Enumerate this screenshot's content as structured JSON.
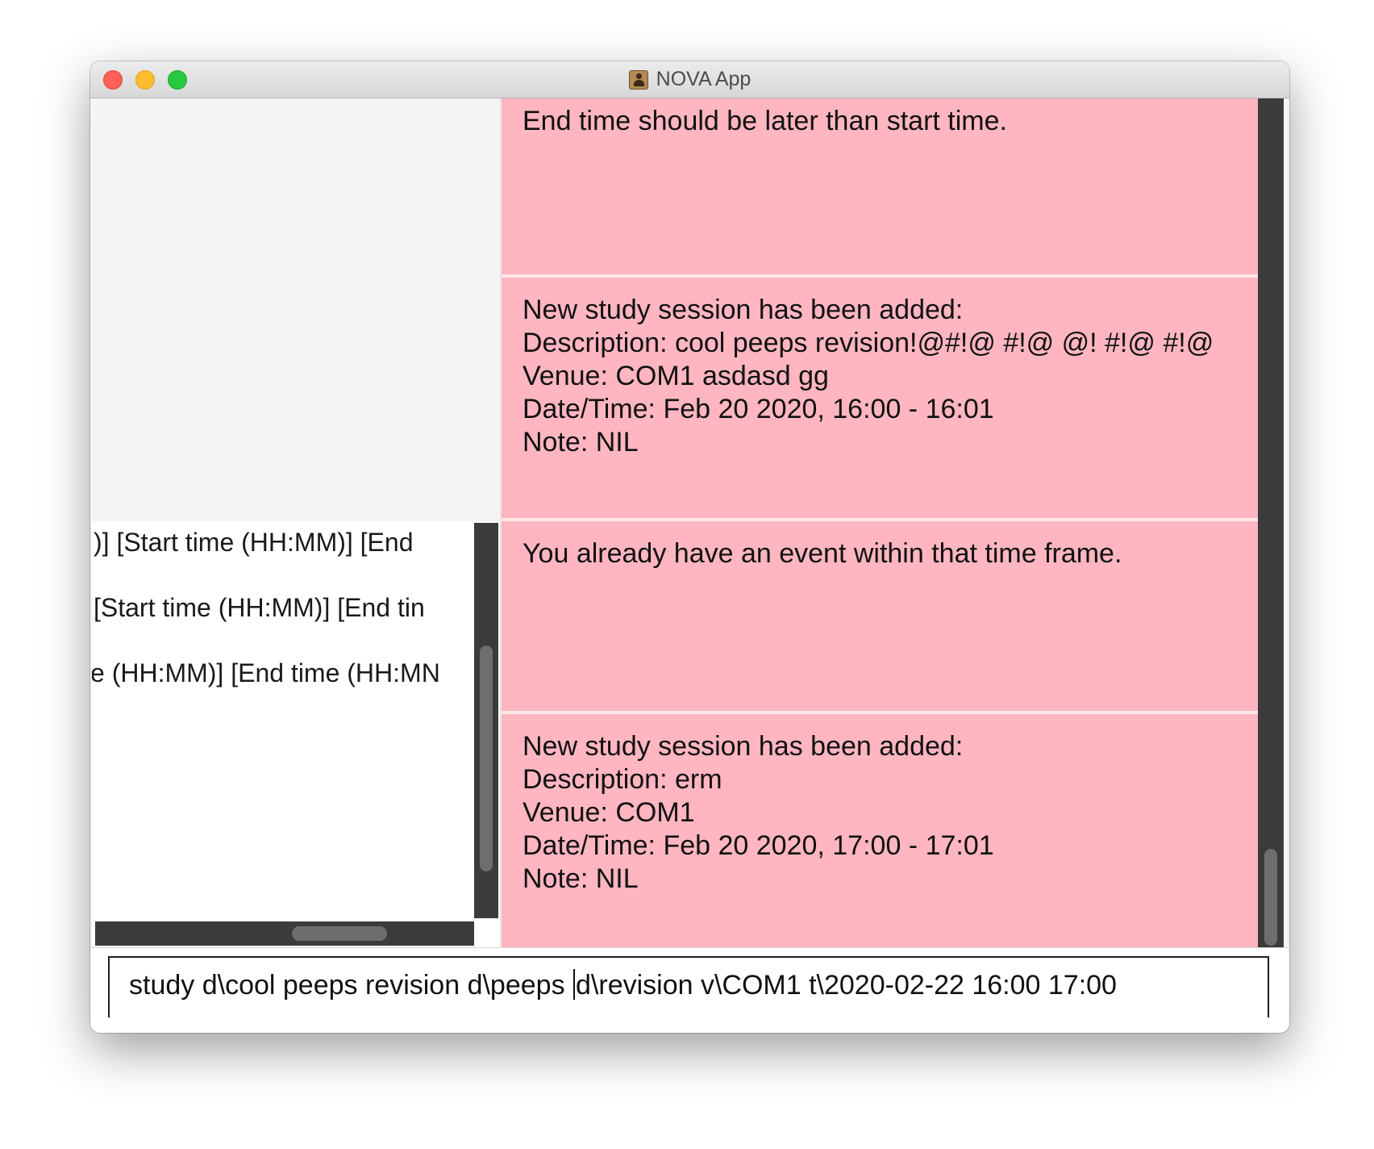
{
  "window": {
    "title": "NOVA App",
    "icon": "address-book-icon"
  },
  "help_panel": {
    "lines": [
      ")] [Start time (HH:MM)] [End",
      "[Start time (HH:MM)] [End tin",
      "e (HH:MM)] [End time (HH:MN"
    ]
  },
  "results": {
    "cards": [
      {
        "lines": [
          "End time should be later than start time."
        ]
      },
      {
        "lines": [
          "New study session has been added:",
          "Description: cool peeps revision!@#!@ #!@ @! #!@ #!@",
          "Venue: COM1 asdasd gg",
          "Date/Time: Feb 20 2020, 16:00 - 16:01",
          "Note: NIL"
        ]
      },
      {
        "lines": [
          "You already have an event within that time frame."
        ]
      },
      {
        "lines": [
          "New study session has been added:",
          "Description: erm",
          "Venue: COM1",
          "Date/Time: Feb 20 2020, 17:00 - 17:01",
          "Note: NIL"
        ]
      }
    ]
  },
  "command": {
    "before_caret": "study d\\cool peeps revision d\\peeps ",
    "after_caret": "d\\revision v\\COM1 t\\2020-02-22 16:00 17:00"
  },
  "colors": {
    "result_background": "#ffb6c1",
    "scrollbar_track": "#3b3b3b",
    "scrollbar_thumb": "#6e6e6e"
  }
}
